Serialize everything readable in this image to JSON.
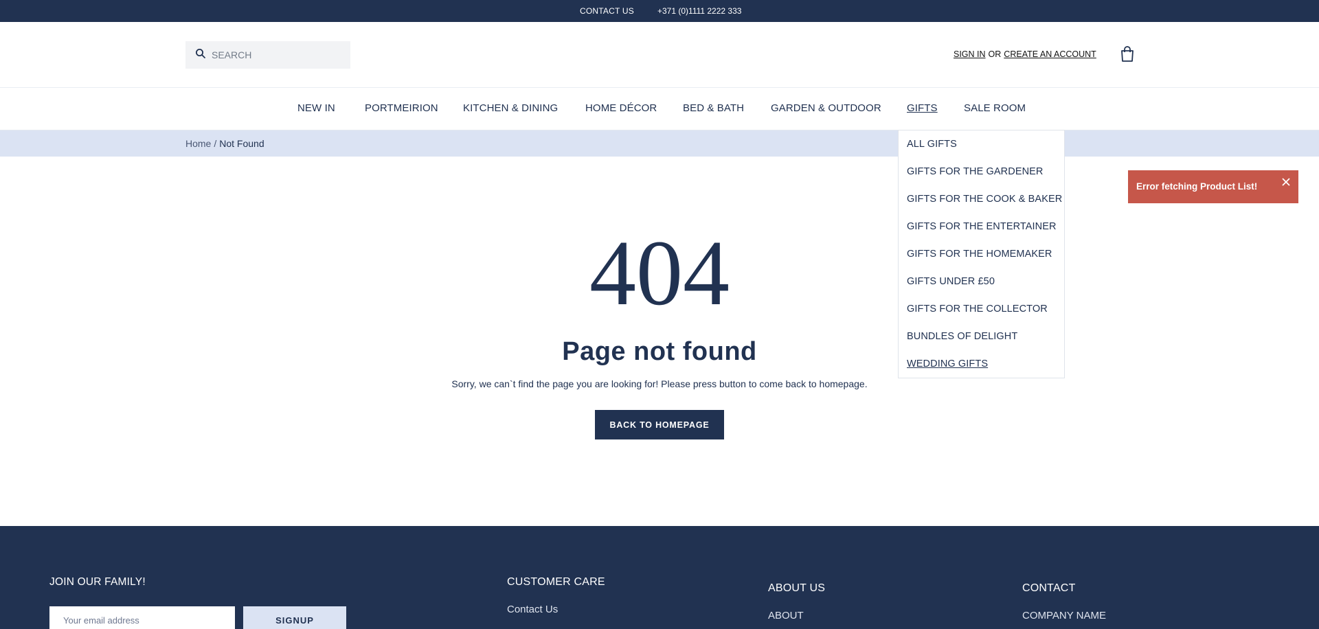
{
  "topbar": {
    "contact_label": "CONTACT US",
    "phone": "+371 (0)1111 2222 333"
  },
  "header": {
    "search_placeholder": "SEARCH",
    "sign_in": "SIGN IN",
    "or": "OR",
    "create_account": "CREATE AN ACCOUNT"
  },
  "nav": {
    "items": [
      {
        "label": "NEW IN"
      },
      {
        "label": "PORTMEIRION"
      },
      {
        "label": "KITCHEN & DINING"
      },
      {
        "label": "HOME DÉCOR"
      },
      {
        "label": "BED & BATH"
      },
      {
        "label": "GARDEN & OUTDOOR"
      },
      {
        "label": "GIFTS",
        "active": true
      },
      {
        "label": "SALE ROOM"
      }
    ]
  },
  "breadcrumb": {
    "home": "Home",
    "separator": "/",
    "current": "Not Found"
  },
  "gifts_dropdown": {
    "items": [
      "ALL GIFTS",
      "GIFTS FOR THE GARDENER",
      "GIFTS FOR THE COOK & BAKER",
      "GIFTS FOR THE ENTERTAINER",
      "GIFTS FOR THE HOMEMAKER",
      "GIFTS UNDER £50",
      "GIFTS FOR THE COLLECTOR",
      "BUNDLES OF DELIGHT",
      "WEDDING GIFTS"
    ]
  },
  "toast": {
    "message": "Error fetching Product List!",
    "color": "#c6574a"
  },
  "main": {
    "code": "404",
    "title": "Page not found",
    "message": "Sorry, we can`t find the page you are looking for! Please press button to come back to homepage.",
    "button": "BACK TO HOMEPAGE"
  },
  "footer": {
    "join_title": "JOIN OUR FAMILY!",
    "email_placeholder": "Your email address",
    "signup": "SIGNUP",
    "customer_care": {
      "heading": "CUSTOMER CARE",
      "first_link": "Contact Us"
    },
    "about_us": {
      "heading": "ABOUT US",
      "first_link": "ABOUT"
    },
    "contact": {
      "heading": "CONTACT",
      "first_line": "COMPANY NAME"
    }
  },
  "colors": {
    "brand_navy": "#213251",
    "light_blue": "#dbe3f3",
    "error_red": "#c6574a"
  }
}
